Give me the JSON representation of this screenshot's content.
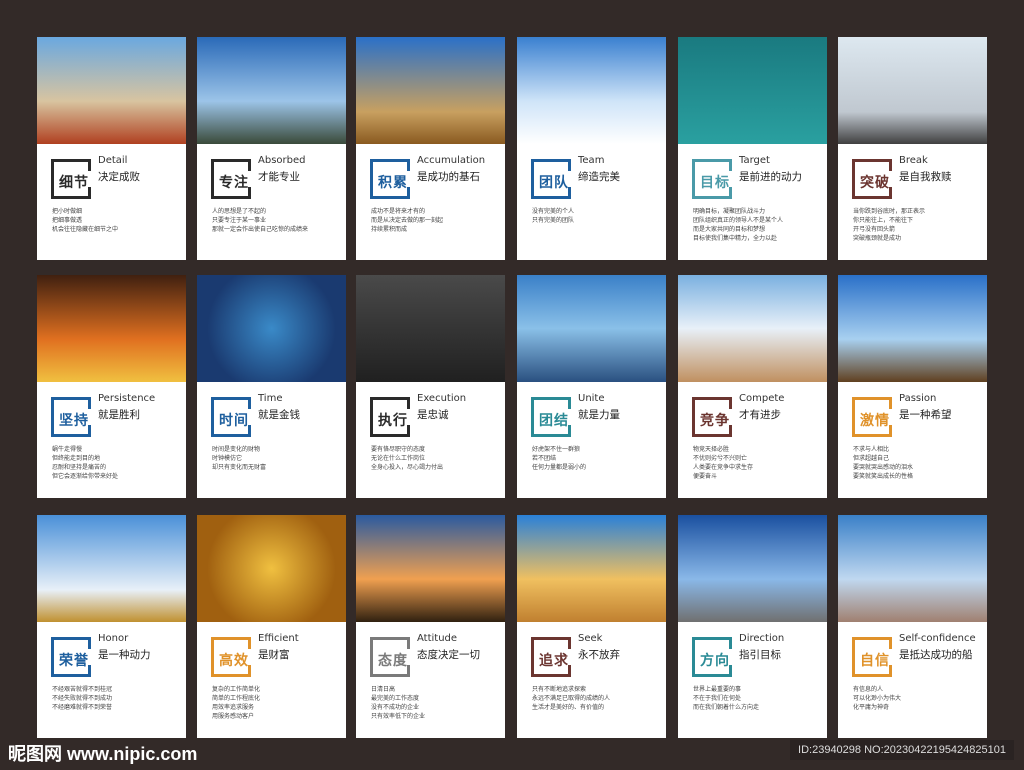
{
  "cards": [
    {
      "title": "细节",
      "en": "Detail",
      "cn": "决定成败",
      "lines": [
        "把小时做细",
        "把细事做透",
        "机会往往隐藏在细节之中"
      ],
      "color": "#2a2a2a"
    },
    {
      "title": "专注",
      "en": "Absorbed",
      "cn": "才能专业",
      "lines": [
        "人的思想是了不起的",
        "只要专注于某一事业",
        "那就一定会作出使自己吃惊的成绩来"
      ],
      "color": "#2a2a2a"
    },
    {
      "title": "积累",
      "en": "Accumulation",
      "cn": "是成功的基石",
      "lines": [
        "成功不是将来才有的",
        "而是从决定去做的那一刻起",
        "持续累积而成"
      ],
      "color": "#1e5f9e"
    },
    {
      "title": "团队",
      "en": "Team",
      "cn": "缔造完美",
      "lines": [
        "没有完美的个人",
        "只有完美的团队"
      ],
      "color": "#1e5f9e"
    },
    {
      "title": "目标",
      "en": "Target",
      "cn": "是前进的动力",
      "lines": [
        "明确目标，凝聚团队战斗力",
        "团队组织真正的领导人不是某个人",
        "而是大家共同的目标和梦想",
        "目标使我们集中精力，全力以赴"
      ],
      "color": "#4a9aa8"
    },
    {
      "title": "突破",
      "en": "Break",
      "cn": "是自我救赎",
      "lines": [
        "当你跌到谷底时，那正表示",
        "你只能往上，不能往下",
        "开弓没有回头箭",
        "突破瓶颈就是成功"
      ],
      "color": "#6b3530"
    },
    {
      "title": "坚持",
      "en": "Persistence",
      "cn": "就是胜利",
      "lines": [
        "蜗牛走得慢",
        "但终能走到目的地",
        "忍耐和坚持是痛苦的",
        "但它会逐渐给你带来好处"
      ],
      "color": "#1e5f9e"
    },
    {
      "title": "时间",
      "en": "Time",
      "cn": "就是金钱",
      "lines": [
        "时间是变化的财物",
        "时钟模仿它",
        "却只有变化而无财富"
      ],
      "color": "#1e5f9e"
    },
    {
      "title": "执行",
      "en": "Execution",
      "cn": "是忠诚",
      "lines": [
        "要有恪尽职守的态度",
        "无论在什么工作岗位",
        "全身心投入，尽心竭力付出"
      ],
      "color": "#2a2a2a"
    },
    {
      "title": "团结",
      "en": "Unite",
      "cn": "就是力量",
      "lines": [
        "好虎架不住一群狼",
        "若不团结",
        "任何力量都是弱小的"
      ],
      "color": "#2a8a95"
    },
    {
      "title": "竞争",
      "en": "Compete",
      "cn": "才有进步",
      "lines": [
        "物竞天择必胜",
        "不优则劣兮不兴则亡",
        "人类要在竞争中求生存",
        "便要奋斗"
      ],
      "color": "#6b3530"
    },
    {
      "title": "激情",
      "en": "Passion",
      "cn": "是一种希望",
      "lines": [
        "不求与人相比",
        "但求超越自己",
        "要哭就哭出感动的泪水",
        "要笑就笑出成长的性格"
      ],
      "color": "#e0922a"
    },
    {
      "title": "荣誉",
      "en": "Honor",
      "cn": "是一种动力",
      "lines": [
        "不经艰苦就得不到桂冠",
        "不经失败就得不到成功",
        "不经磨难就得不到荣誉"
      ],
      "color": "#1e5f9e"
    },
    {
      "title": "高效",
      "en": "Efficient",
      "cn": "是财富",
      "lines": [
        "复杂的工作简单化",
        "简单的工作程底化",
        "用效率追求服务",
        "用服务感动客户"
      ],
      "color": "#e0922a"
    },
    {
      "title": "态度",
      "en": "Attitude",
      "cn": "态度决定一切",
      "lines": [
        "日清日高",
        "最完美的工作态度",
        "没有不成功的企业",
        "只有效率低下的企业"
      ],
      "color": "#7a7a7a"
    },
    {
      "title": "追求",
      "en": "Seek",
      "cn": "永不放弃",
      "lines": [
        "只有不断地追求探索",
        "永远不满足已取得的成绩的人",
        "生活才是美好的、有价值的"
      ],
      "color": "#6b3530"
    },
    {
      "title": "方向",
      "en": "Direction",
      "cn": "指引目标",
      "lines": [
        "世界上最重要的事",
        "不在于我们在何处",
        "而在我们朝着什么方向走"
      ],
      "color": "#2a8a95"
    },
    {
      "title": "自信",
      "en": "Self-confidence",
      "cn": "是抵达成功的船",
      "lines": [
        "有信息的人",
        "可以化渺小为伟大",
        "化平庸为神奇"
      ],
      "color": "#e0922a"
    }
  ],
  "watermark": "昵图网 www.nipic.com",
  "id_text": "ID:23940298 NO:20230422195424825101"
}
